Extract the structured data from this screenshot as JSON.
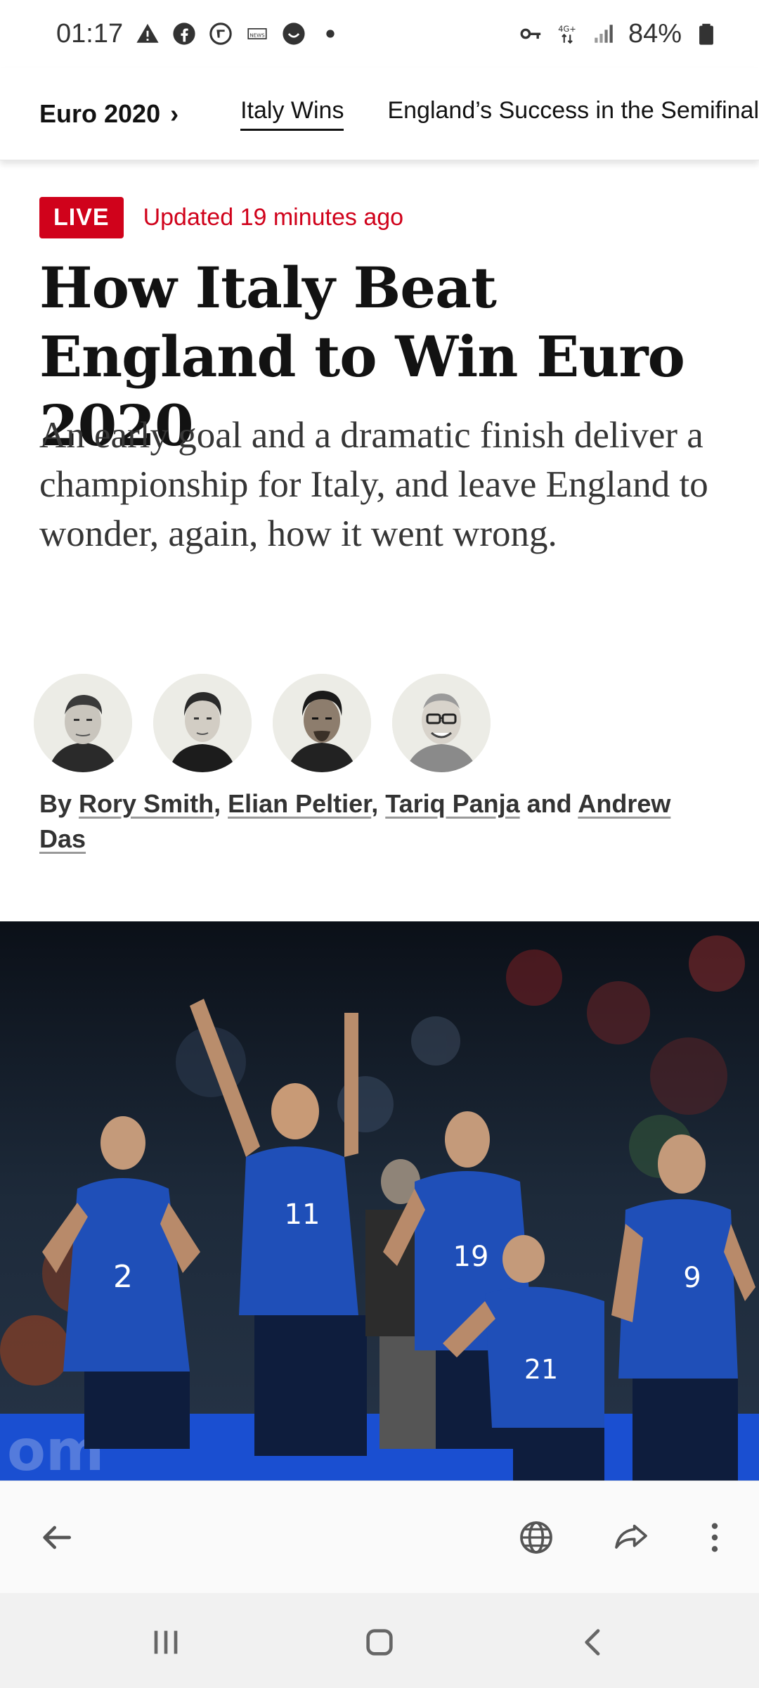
{
  "status_bar": {
    "time": "01:17",
    "battery": "84%",
    "network": "4G+"
  },
  "section_nav": {
    "section": "Euro 2020",
    "section_chevron": "›",
    "tabs": [
      {
        "label": "Italy Wins",
        "active": true
      },
      {
        "label": "England’s Success in the Semifinal",
        "active": false
      }
    ]
  },
  "article": {
    "live_label": "LIVE",
    "updated": "Updated 19 minutes ago",
    "headline": "How Italy Beat England to Win Euro 2020",
    "summary": "An early goal and a dramatic finish deliver a championship for Italy, and leave England to wonder, again, how it went wrong.",
    "byline": {
      "prefix": "By",
      "authors": [
        "Rory Smith",
        "Elian Peltier",
        "Tariq Panja",
        "Andrew Das"
      ],
      "sep1": ",",
      "sep2": ",",
      "and": "and"
    }
  },
  "browser_toolbar": {
    "icons": [
      "back-arrow-icon",
      "globe-icon",
      "share-icon",
      "more-vert-icon"
    ]
  },
  "system_nav": {
    "icons": [
      "recent-apps-icon",
      "home-icon",
      "back-icon"
    ]
  },
  "colors": {
    "live_red": "#d0021b",
    "text": "#121212",
    "italy_blue": "#1f4fb8"
  }
}
